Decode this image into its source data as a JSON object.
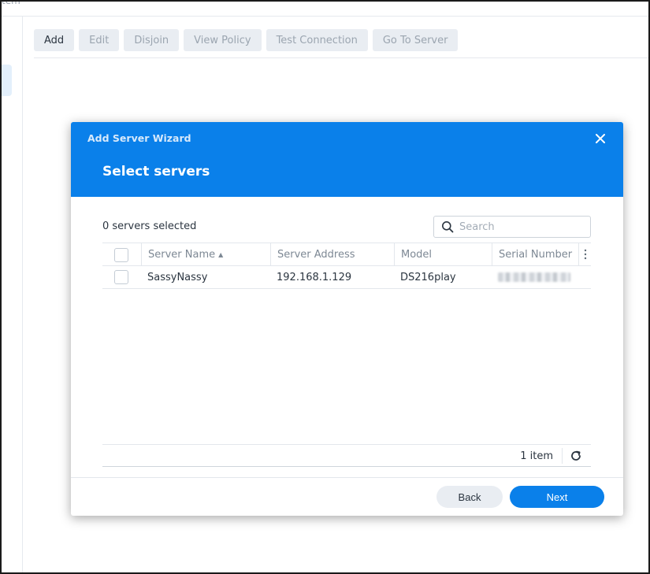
{
  "background": {
    "top_text": "tem",
    "toolbar": [
      {
        "label": "Add",
        "enabled": true
      },
      {
        "label": "Edit",
        "enabled": false
      },
      {
        "label": "Disjoin",
        "enabled": false
      },
      {
        "label": "View Policy",
        "enabled": false
      },
      {
        "label": "Test Connection",
        "enabled": false
      },
      {
        "label": "Go To Server",
        "enabled": false
      }
    ]
  },
  "wizard": {
    "title": "Add Server Wizard",
    "step_title": "Select servers",
    "close_icon": "close-icon",
    "selected_count": "0 servers selected",
    "search": {
      "placeholder": "Search",
      "value": "",
      "icon": "search-icon"
    },
    "columns": [
      "Server Name",
      "Server Address",
      "Model",
      "Serial Number"
    ],
    "sort_indicator": "▲",
    "rows": [
      {
        "server_name": "SassyNassy",
        "server_address": "192.168.1.129",
        "model": "DS216play",
        "serial_number_blurred": true
      }
    ],
    "item_count": "1 item",
    "refresh_icon": "refresh-icon",
    "buttons": {
      "back": "Back",
      "next": "Next"
    }
  },
  "colors": {
    "accent": "#0a80ea",
    "header_text_muted": "#d7e9fb",
    "disabled_text": "#9ba5b0",
    "button_gray": "#e9edf2"
  }
}
